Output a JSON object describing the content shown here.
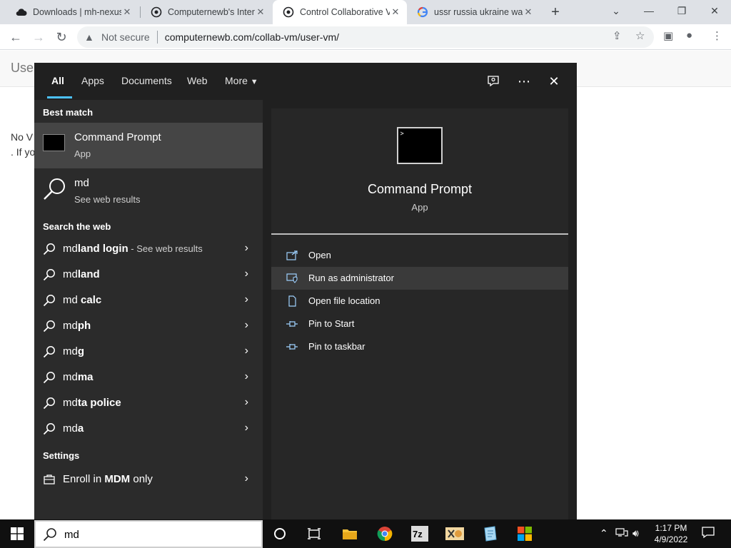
{
  "browser": {
    "tabs": [
      {
        "title": "Downloads | mh-nexus",
        "favicon": "cloud-icon"
      },
      {
        "title": "Computernewb's Intern",
        "favicon": "computernewb-icon"
      },
      {
        "title": "Control Collaborative V",
        "favicon": "computernewb-icon"
      },
      {
        "title": "ussr russia ukraine war",
        "favicon": "google-icon"
      }
    ],
    "active_tab": 2,
    "security_label": "Not secure",
    "url": "computernewb.com/collab-vm/user-vm/"
  },
  "page": {
    "title": "Use",
    "line1": "No V",
    "line2": ". If yo"
  },
  "search": {
    "filters": [
      "All",
      "Apps",
      "Documents",
      "Web",
      "More"
    ],
    "active_filter": "All",
    "best_match_header": "Best match",
    "best_match": {
      "title": "Command Prompt",
      "subtitle": "App"
    },
    "web_result": {
      "title": "md",
      "subtitle": "See web results"
    },
    "web_header": "Search the web",
    "web_suggestions": [
      {
        "prefix": "md",
        "bold": "land login",
        "hint": " - See web results"
      },
      {
        "prefix": "md",
        "bold": "land",
        "hint": ""
      },
      {
        "prefix": "md",
        "bold": " calc",
        "hint": ""
      },
      {
        "prefix": "md",
        "bold": "ph",
        "hint": ""
      },
      {
        "prefix": "md",
        "bold": "g",
        "hint": ""
      },
      {
        "prefix": "md",
        "bold": "ma",
        "hint": ""
      },
      {
        "prefix": "md",
        "bold": "ta police",
        "hint": ""
      },
      {
        "prefix": "md",
        "bold": "a",
        "hint": ""
      }
    ],
    "settings_header": "Settings",
    "settings_item": {
      "prefix": "Enroll in ",
      "bold": "MDM",
      "suffix": " only"
    },
    "preview": {
      "title": "Command Prompt",
      "subtitle": "App",
      "actions": [
        "Open",
        "Run as administrator",
        "Open file location",
        "Pin to Start",
        "Pin to taskbar"
      ],
      "hover_action": 1
    },
    "query": "md"
  },
  "taskbar": {
    "time": "1:17 PM",
    "date": "4/9/2022",
    "apps": [
      "cortana-icon",
      "task-view-icon",
      "file-explorer-icon",
      "chrome-icon",
      "7zip-icon",
      "hex-editor-icon",
      "notepad-icon",
      "store-icon"
    ]
  },
  "colors": {
    "accent": "#4cc2ff",
    "panel": "#202020",
    "results": "#2b2b2b"
  }
}
